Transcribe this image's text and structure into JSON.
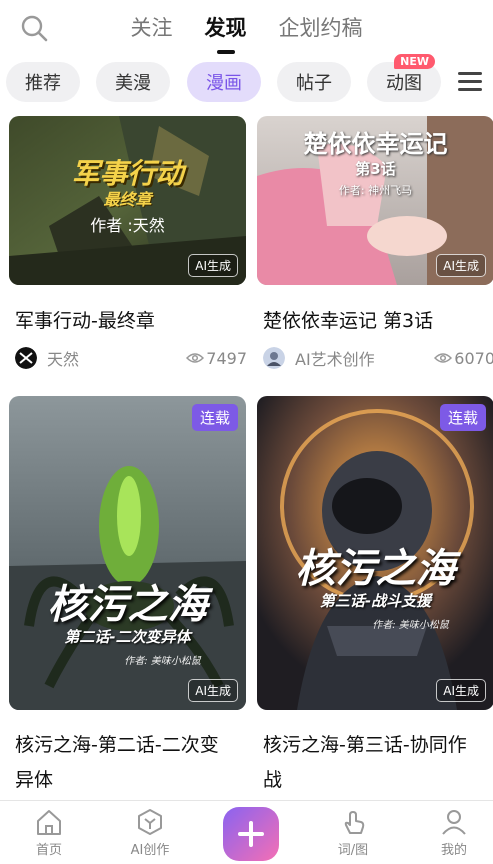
{
  "header": {
    "tabs": [
      {
        "label": "关注",
        "active": false
      },
      {
        "label": "发现",
        "active": true
      },
      {
        "label": "企划约稿",
        "active": false
      }
    ]
  },
  "categories": {
    "items": [
      {
        "label": "推荐",
        "active": false
      },
      {
        "label": "美漫",
        "active": false
      },
      {
        "label": "漫画",
        "active": true
      },
      {
        "label": "帖子",
        "active": false
      },
      {
        "label": "动图",
        "active": false,
        "badge": "NEW"
      }
    ]
  },
  "feed": {
    "cards": [
      {
        "cover_title": "军事行动",
        "cover_subtitle": "最终章",
        "cover_author": "作者 :天然",
        "ai_badge": "AI生成",
        "title": "军事行动-最终章",
        "author": "天然",
        "views": "7497"
      },
      {
        "cover_title": "楚依依幸运记",
        "cover_subtitle": "第3话",
        "cover_author": "作者: 神州飞马",
        "ai_badge": "AI生成",
        "title": "楚依依幸运记 第3话",
        "author": "AI艺术创作",
        "views": "6070"
      },
      {
        "serial_badge": "连载",
        "cover_title": "核污之海",
        "cover_subtitle": "第二话-二次变异体",
        "cover_author": "作者: 美味小松鼠",
        "ai_badge": "AI生成",
        "title_line1": "核污之海-第二话-二次变",
        "title_line2": "异体"
      },
      {
        "serial_badge": "连载",
        "cover_title": "核污之海",
        "cover_subtitle": "第三话-战斗支援",
        "cover_author": "作者: 美味小松鼠",
        "ai_badge": "AI生成",
        "title_line1": "核污之海-第三话-协同作",
        "title_line2": "战"
      }
    ]
  },
  "bottom_nav": {
    "items": [
      {
        "label": "首页"
      },
      {
        "label": "AI创作"
      },
      {
        "label": "词/图"
      },
      {
        "label": "我的"
      }
    ]
  },
  "colors": {
    "accent": "#7d5ae6",
    "chip_active_bg": "#e3dcfb",
    "new_badge": "#ff5a6e"
  }
}
